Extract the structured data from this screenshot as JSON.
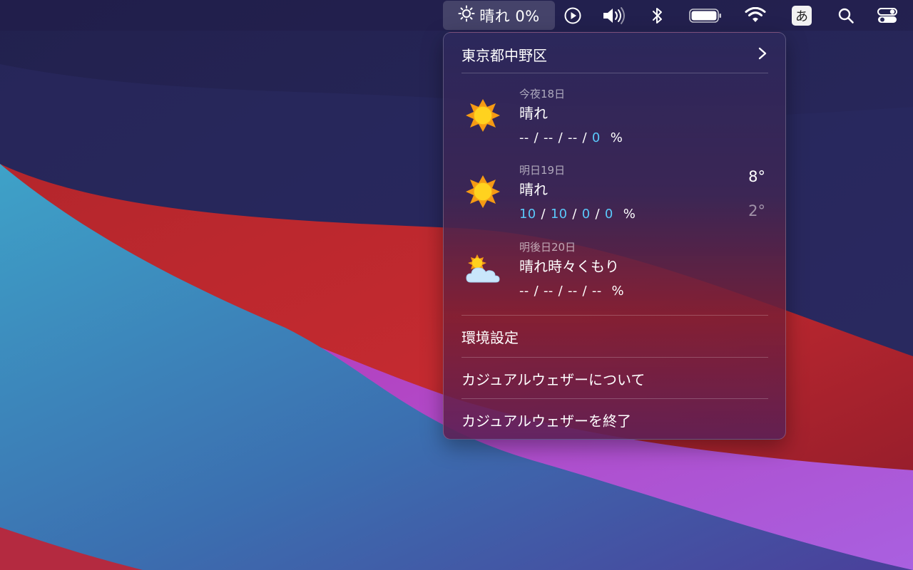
{
  "menubar": {
    "weather_status": "晴れ 0%",
    "ime_label": "あ",
    "icons": [
      "sun-icon",
      "play-icon",
      "volume-icon",
      "bluetooth-icon",
      "battery-icon",
      "wifi-icon",
      "input-method-icon",
      "search-icon",
      "control-center-icon"
    ]
  },
  "panel": {
    "location": "東京都中野区",
    "forecast": [
      {
        "date": "今夜18日",
        "condition": "晴れ",
        "icon": "sun-icon",
        "precip": [
          {
            "v": "--",
            "blue": false
          },
          {
            "v": "--",
            "blue": false
          },
          {
            "v": "--",
            "blue": false
          },
          {
            "v": "0",
            "blue": true
          }
        ],
        "unit": "%",
        "high": "",
        "low": ""
      },
      {
        "date": "明日19日",
        "condition": "晴れ",
        "icon": "sun-icon",
        "precip": [
          {
            "v": "10",
            "blue": true
          },
          {
            "v": "10",
            "blue": true
          },
          {
            "v": "0",
            "blue": true
          },
          {
            "v": "0",
            "blue": true
          }
        ],
        "unit": "%",
        "high": "8°",
        "low": "2°"
      },
      {
        "date": "明後日20日",
        "condition": "晴れ時々くもり",
        "icon": "partly-cloudy-icon",
        "precip": [
          {
            "v": "--",
            "blue": false
          },
          {
            "v": "--",
            "blue": false
          },
          {
            "v": "--",
            "blue": false
          },
          {
            "v": "--",
            "blue": false
          }
        ],
        "unit": "%",
        "high": "",
        "low": ""
      }
    ],
    "menu": {
      "preferences": "環境設定",
      "about": "カジュアルウェザーについて",
      "quit": "カジュアルウェザーを終了"
    }
  },
  "colors": {
    "precip_blue": "#5ac8fa",
    "sun_orange": "#f59a14",
    "sun_yellow": "#ffd21f"
  }
}
